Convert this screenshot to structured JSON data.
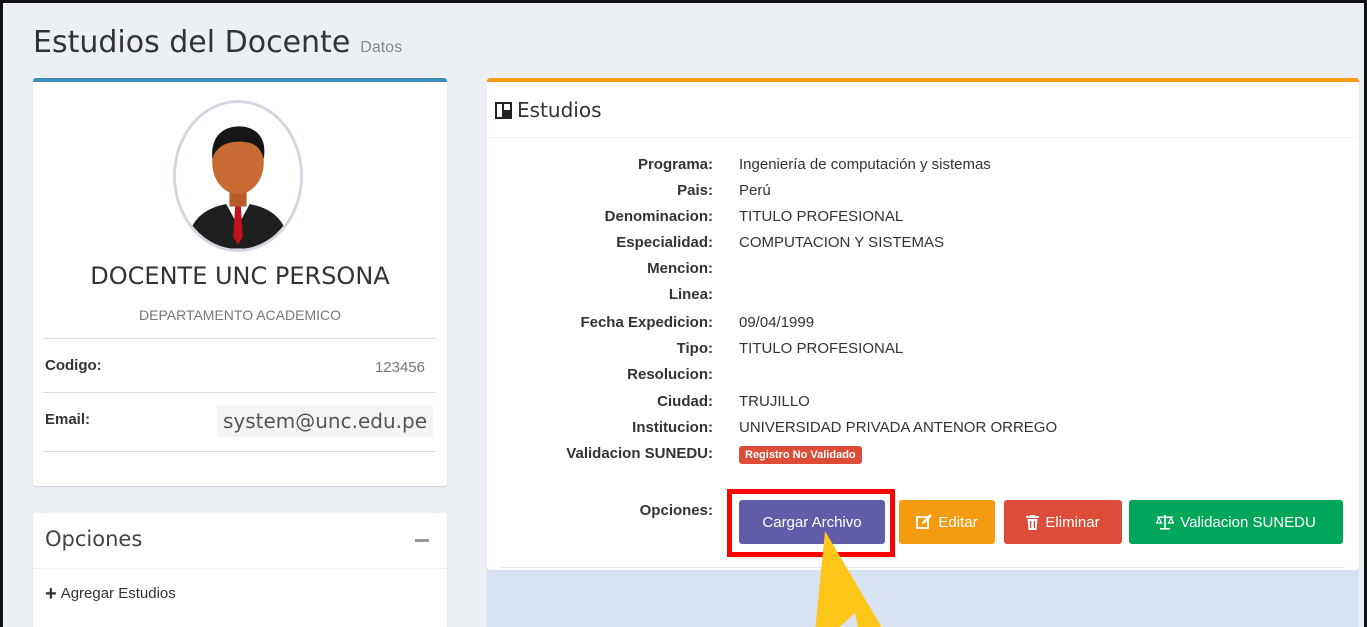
{
  "header": {
    "title": "Estudios del Docente",
    "subtitle": "Datos"
  },
  "profile": {
    "name": "DOCENTE UNC PERSONA",
    "department": "DEPARTAMENTO ACADEMICO",
    "codigo_label": "Codigo:",
    "codigo_value": "123456",
    "email_label": "Email:",
    "email_value": "system@unc.edu.pe"
  },
  "opciones": {
    "title": "Opciones",
    "add_label": "Agregar Estudios"
  },
  "estudios": {
    "title": "Estudios",
    "fields": [
      {
        "label": "Programa:",
        "value": "Ingeniería de computación y sistemas"
      },
      {
        "label": "Pais:",
        "value": "Perú"
      },
      {
        "label": "Denominacion:",
        "value": "TITULO PROFESIONAL"
      },
      {
        "label": "Especialidad:",
        "value": "COMPUTACION Y SISTEMAS"
      },
      {
        "label": "Mencion:",
        "value": ""
      },
      {
        "label": "Linea:",
        "value": ""
      },
      {
        "label": "Fecha Expedicion:",
        "value": "09/04/1999"
      },
      {
        "label": "Tipo:",
        "value": "TITULO PROFESIONAL"
      },
      {
        "label": "Resolucion:",
        "value": ""
      },
      {
        "label": "Ciudad:",
        "value": "TRUJILLO"
      },
      {
        "label": "Institucion:",
        "value": "UNIVERSIDAD PRIVADA ANTENOR ORREGO"
      }
    ],
    "validacion_label": "Validacion SUNEDU:",
    "validacion_badge": "Registro No Validado",
    "opciones_label": "Opciones:",
    "buttons": {
      "cargar": "Cargar Archivo",
      "editar": "Editar",
      "eliminar": "Eliminar",
      "sunedu": "Validacion SUNEDU"
    }
  },
  "colors": {
    "profile_accent": "#3c8dbc",
    "estudios_accent": "#f39c12",
    "cargar": "#605ca8",
    "editar": "#f39c12",
    "eliminar": "#dd4b39",
    "sunedu": "#00a65a",
    "highlight": "#ff0000",
    "arrow": "#ffc61a"
  }
}
